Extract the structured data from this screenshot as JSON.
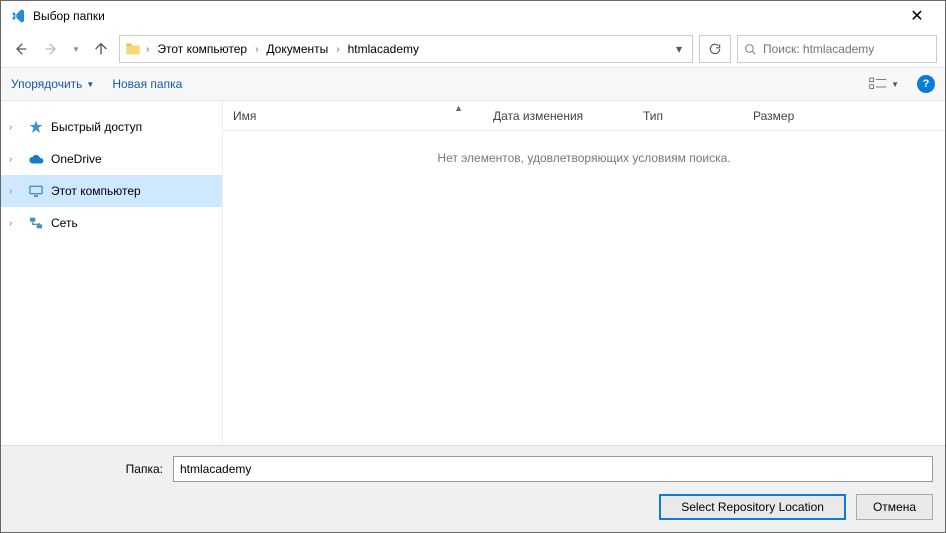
{
  "window": {
    "title": "Выбор папки"
  },
  "breadcrumbs": {
    "seg0": "Этот компьютер",
    "seg1": "Документы",
    "seg2": "htmlacademy"
  },
  "search": {
    "placeholder": "Поиск: htmlacademy"
  },
  "toolbar": {
    "organize": "Упорядочить",
    "newfolder": "Новая папка"
  },
  "sidebar": {
    "quick": "Быстрый доступ",
    "onedrive": "OneDrive",
    "thispc": "Этот компьютер",
    "network": "Сеть"
  },
  "columns": {
    "name": "Имя",
    "date": "Дата изменения",
    "type": "Тип",
    "size": "Размер"
  },
  "empty_text": "Нет элементов, удовлетворяющих условиям поиска.",
  "footer": {
    "folder_label": "Папка:",
    "folder_value": "htmlacademy",
    "primary": "Select Repository Location",
    "cancel": "Отмена"
  }
}
